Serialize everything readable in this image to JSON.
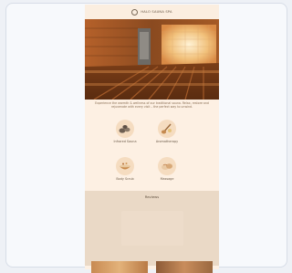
{
  "header": {
    "brand": "HALO SAUNA SPA",
    "logo_icon": "halo-ring-icon"
  },
  "hero": {
    "icon": "sauna-room-photo"
  },
  "intro": {
    "text": "Experience the warmth & wellness of our traditional sauna. Relax, restore and rejuvenate with every visit – the perfect way to unwind."
  },
  "features": [
    {
      "label": "Infrared Sauna",
      "icon": "stones-icon"
    },
    {
      "label": "Aromatherapy",
      "icon": "ladle-icon"
    },
    {
      "label": "Body Scrub",
      "icon": "bowl-icon"
    },
    {
      "label": "Massage",
      "icon": "towels-icon"
    }
  ],
  "reviews": {
    "title": "Reviews"
  },
  "colors": {
    "page_bg": "#fdf0e3",
    "reviews_bg": "#ead9c6",
    "accent": "#c98a4b"
  }
}
